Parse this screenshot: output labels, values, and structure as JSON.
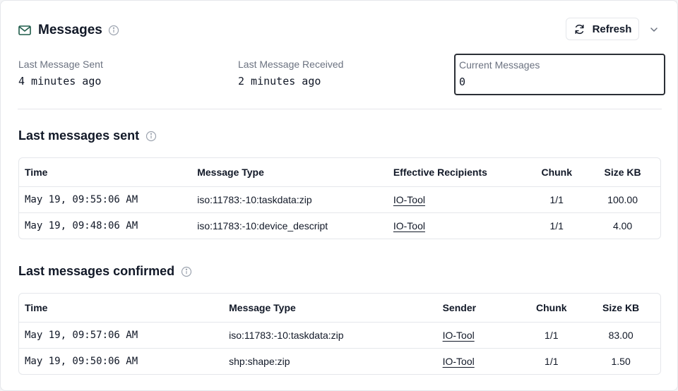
{
  "header": {
    "title": "Messages",
    "refresh_label": "Refresh"
  },
  "stats": {
    "last_sent_label": "Last Message Sent",
    "last_sent_value": "4 minutes ago",
    "last_received_label": "Last Message Received",
    "last_received_value": "2 minutes ago",
    "current_label": "Current Messages",
    "current_value": "0"
  },
  "sent": {
    "title": "Last messages sent",
    "columns": [
      "Time",
      "Message Type",
      "Effective Recipients",
      "Chunk",
      "Size KB"
    ],
    "rows": [
      {
        "time": "May 19, 09:55:06 AM",
        "type": "iso:11783:-10:taskdata:zip",
        "recipient": "IO-Tool",
        "chunk": "1/1",
        "size": "100.00"
      },
      {
        "time": "May 19, 09:48:06 AM",
        "type": "iso:11783:-10:device_descript",
        "recipient": "IO-Tool",
        "chunk": "1/1",
        "size": "4.00"
      }
    ]
  },
  "confirmed": {
    "title": "Last messages confirmed",
    "columns": [
      "Time",
      "Message Type",
      "Sender",
      "Chunk",
      "Size KB"
    ],
    "rows": [
      {
        "time": "May 19, 09:57:06 AM",
        "type": "iso:11783:-10:taskdata:zip",
        "sender": "IO-Tool",
        "chunk": "1/1",
        "size": "83.00"
      },
      {
        "time": "May 19, 09:50:06 AM",
        "type": "shp:shape:zip",
        "sender": "IO-Tool",
        "chunk": "1/1",
        "size": "1.50"
      }
    ]
  },
  "icons": {
    "mail": "envelope-icon",
    "info": "info-icon",
    "refresh": "refresh-icon",
    "chevron": "chevron-down-icon"
  },
  "colors": {
    "mail_icon": "#1f5c4a",
    "muted": "#6b7280",
    "border": "#e5e7eb",
    "highlight_border": "#2b2f36"
  }
}
